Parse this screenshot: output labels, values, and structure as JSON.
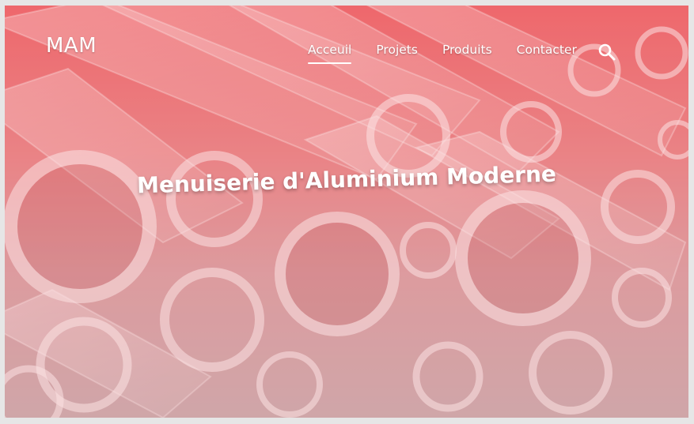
{
  "brand": {
    "logo": "MAM"
  },
  "nav": {
    "items": [
      {
        "label": "Acceuil",
        "active": true
      },
      {
        "label": "Projets",
        "active": false
      },
      {
        "label": "Produits",
        "active": false
      },
      {
        "label": "Contacter",
        "active": false
      }
    ],
    "search_icon": "search-icon"
  },
  "hero": {
    "headline": "Menuiserie d'Aluminium Moderne"
  },
  "colors": {
    "accent_top": "#ee6a6e",
    "accent_bottom": "#c9b6b8",
    "text": "#ffffff"
  }
}
